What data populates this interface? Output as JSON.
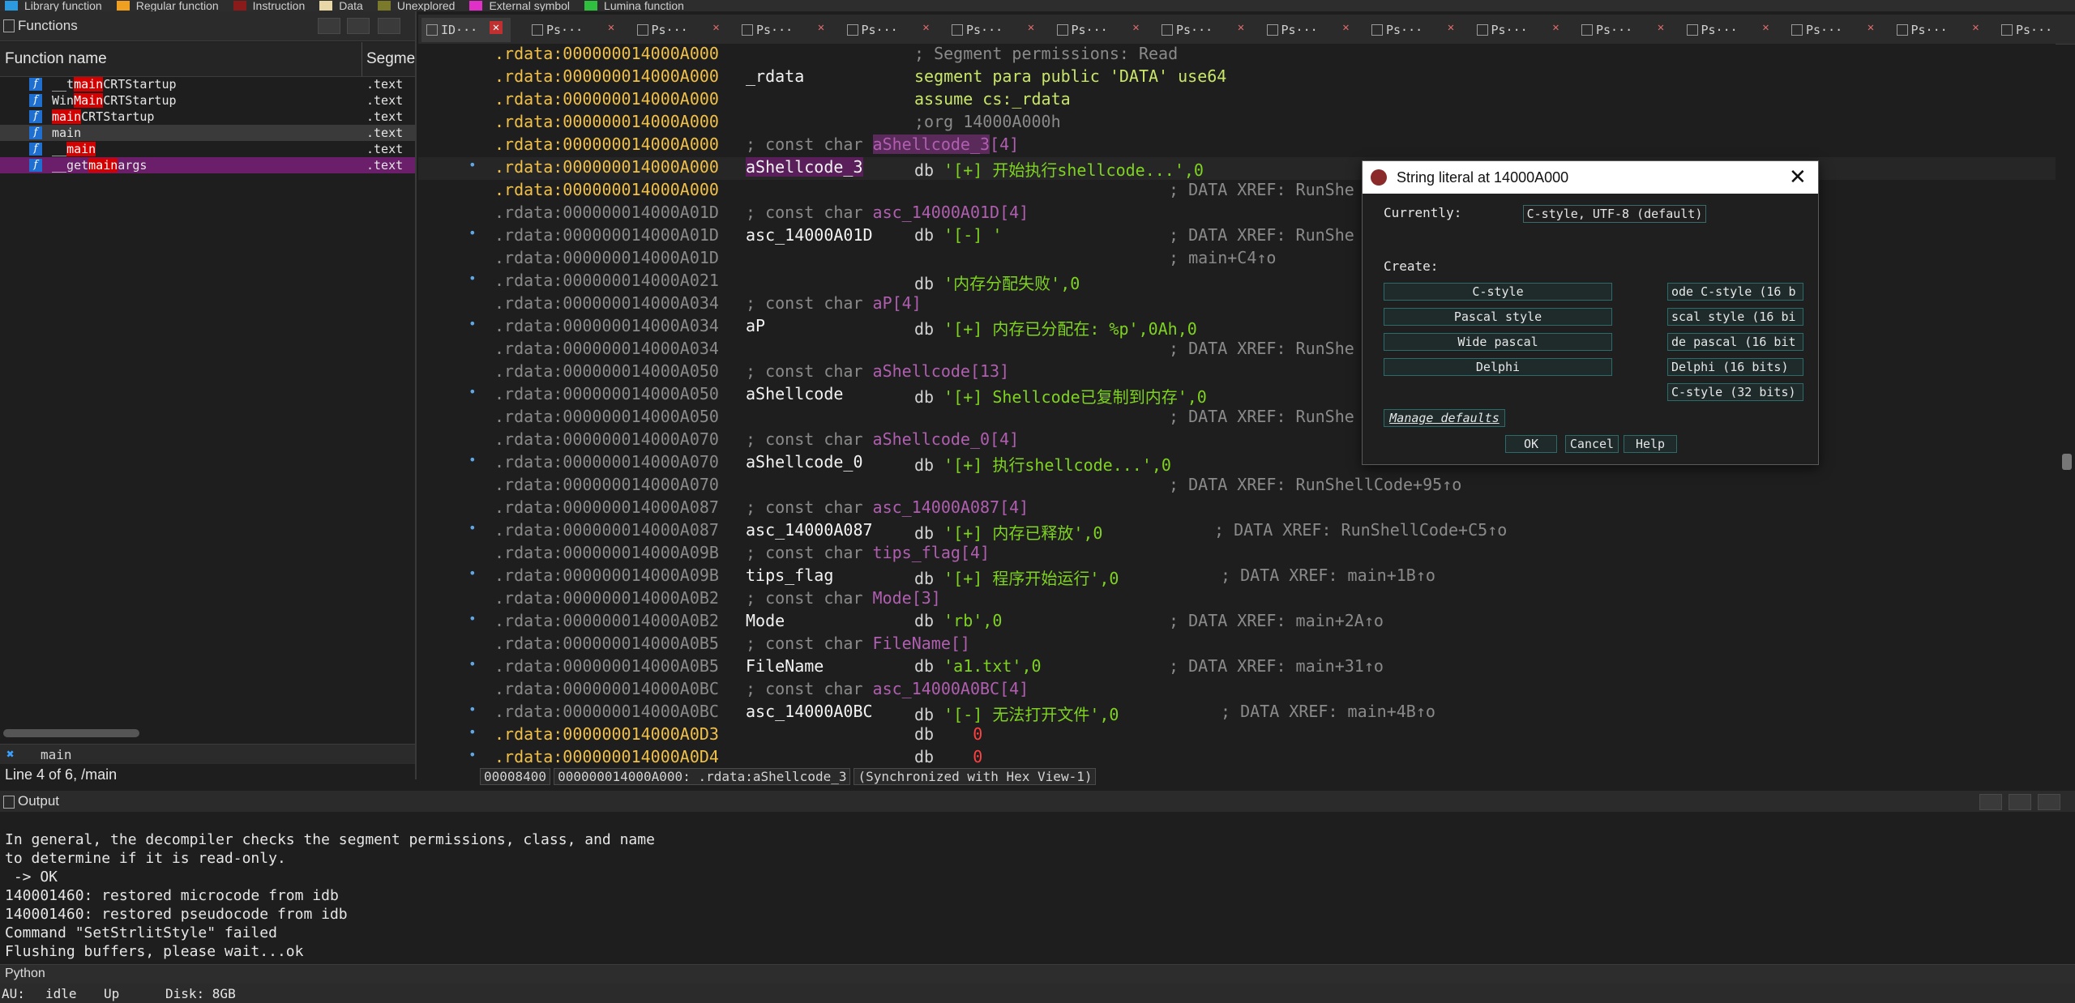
{
  "legend": [
    {
      "label": "Library function",
      "color": "#2b9ae0"
    },
    {
      "label": "Regular function",
      "color": "#f0a020"
    },
    {
      "label": "Instruction",
      "color": "#8b1a1a"
    },
    {
      "label": "Data",
      "color": "#e8d8a8"
    },
    {
      "label": "Unexplored",
      "color": "#7a7a2a"
    },
    {
      "label": "External symbol",
      "color": "#e030c8"
    },
    {
      "label": "Lumina function",
      "color": "#30c040"
    }
  ],
  "functions": {
    "title": "Functions",
    "col_name": "Function name",
    "col_segment": "Segme",
    "rows": [
      {
        "pre": "__t",
        "hl": "main",
        "post": "CRTStartup",
        "seg": ".text",
        "selected": false
      },
      {
        "pre": "Win",
        "hl": "Main",
        "post": "CRTStartup",
        "seg": ".text",
        "selected": false
      },
      {
        "pre": "",
        "hl": "main",
        "post": "CRTStartup",
        "seg": ".text",
        "selected": false
      },
      {
        "pre": "main",
        "hl": "",
        "post": "",
        "seg": ".text",
        "selected": true
      },
      {
        "pre": "__",
        "hl": "main",
        "post": "",
        "seg": ".text",
        "selected": false
      },
      {
        "pre": "__get",
        "hl": "main",
        "post": "args",
        "seg": ".text",
        "selected": false,
        "purple": true
      }
    ],
    "tab_label": "main",
    "status": "Line 4 of 6, /main"
  },
  "tabs": [
    {
      "label": "ID···",
      "active": true
    },
    {
      "label": "Ps···"
    },
    {
      "label": "Ps···"
    },
    {
      "label": "Ps···"
    },
    {
      "label": "Ps···"
    },
    {
      "label": "Ps···"
    },
    {
      "label": "Ps···"
    },
    {
      "label": "Ps···"
    },
    {
      "label": "Ps···"
    },
    {
      "label": "Ps···"
    },
    {
      "label": "Ps···"
    },
    {
      "label": "Ps···"
    },
    {
      "label": "Ps···"
    },
    {
      "label": "Ps···"
    },
    {
      "label": "Ps···"
    },
    {
      "label": "Ps···"
    }
  ],
  "disasm": [
    {
      "addr": ".rdata:000000014000A000",
      "addrc": "y",
      "rest": [
        {
          "t": "; Segment permissions: Read",
          "c": "cmt"
        }
      ]
    },
    {
      "addr": ".rdata:000000014000A000",
      "addrc": "y",
      "label": "_rdata",
      "rest": [
        {
          "t": "segment para public 'DATA' use64",
          "c": "kw"
        }
      ]
    },
    {
      "addr": ".rdata:000000014000A000",
      "addrc": "y",
      "rest": [
        {
          "t": "assume cs:_rdata",
          "c": "kw"
        }
      ]
    },
    {
      "addr": ".rdata:000000014000A000",
      "addrc": "y",
      "rest": [
        {
          "t": ";org 14000A000h",
          "c": "cmt"
        }
      ]
    },
    {
      "addr": ".rdata:000000014000A000",
      "addrc": "y",
      "comment": "; const char aShellcode_3[4]"
    },
    {
      "addr": ".rdata:000000014000A000",
      "addrc": "y",
      "dot": true,
      "label": "aShellcode_3",
      "labelhl": true,
      "rest": [
        {
          "t": "db ",
          "c": "op"
        },
        {
          "t": "'[+] 开始执行shellcode...'",
          "c": "str"
        },
        {
          "t": ",0",
          "c": "num"
        }
      ]
    },
    {
      "addr": ".rdata:000000014000A000",
      "addrc": "y",
      "xref": "; DATA XREF: RunShe"
    },
    {
      "addr": ".rdata:000000014000A01D",
      "addrc": "g",
      "comment": "; const char asc_14000A01D[4]"
    },
    {
      "addr": ".rdata:000000014000A01D",
      "addrc": "g",
      "dot": true,
      "label": "asc_14000A01D",
      "rest": [
        {
          "t": "db ",
          "c": "op"
        },
        {
          "t": "'[-] '",
          "c": "str"
        }
      ],
      "xref": "; DATA XREF: RunShe"
    },
    {
      "addr": ".rdata:000000014000A01D",
      "addrc": "g",
      "xref": "; main+C4↑o"
    },
    {
      "addr": ".rdata:000000014000A021",
      "addrc": "g",
      "dot": true,
      "rest": [
        {
          "t": "db ",
          "c": "op"
        },
        {
          "t": "'内存分配失败'",
          "c": "str"
        },
        {
          "t": ",0",
          "c": "num"
        }
      ]
    },
    {
      "addr": ".rdata:000000014000A034",
      "addrc": "g",
      "comment": "; const char aP[4]"
    },
    {
      "addr": ".rdata:000000014000A034",
      "addrc": "g",
      "dot": true,
      "label": "aP",
      "rest": [
        {
          "t": "db ",
          "c": "op"
        },
        {
          "t": "'[+] 内存已分配在: %p'",
          "c": "str"
        },
        {
          "t": ",0Ah,0",
          "c": "num"
        }
      ]
    },
    {
      "addr": ".rdata:000000014000A034",
      "addrc": "g",
      "xref": "; DATA XREF: RunShe"
    },
    {
      "addr": ".rdata:000000014000A050",
      "addrc": "g",
      "comment": "; const char aShellcode[13]"
    },
    {
      "addr": ".rdata:000000014000A050",
      "addrc": "g",
      "dot": true,
      "label": "aShellcode",
      "rest": [
        {
          "t": "db ",
          "c": "op"
        },
        {
          "t": "'[+] Shellcode已复制到内存'",
          "c": "str"
        },
        {
          "t": ",0",
          "c": "num"
        }
      ]
    },
    {
      "addr": ".rdata:000000014000A050",
      "addrc": "g",
      "xref": "; DATA XREF: RunShe"
    },
    {
      "addr": ".rdata:000000014000A070",
      "addrc": "g",
      "comment": "; const char aShellcode_0[4]"
    },
    {
      "addr": ".rdata:000000014000A070",
      "addrc": "g",
      "dot": true,
      "label": "aShellcode_0",
      "rest": [
        {
          "t": "db ",
          "c": "op"
        },
        {
          "t": "'[+] 执行shellcode...'",
          "c": "str"
        },
        {
          "t": ",0",
          "c": "num"
        }
      ]
    },
    {
      "addr": ".rdata:000000014000A070",
      "addrc": "g",
      "xref": "; DATA XREF: RunShellCode+95↑o"
    },
    {
      "addr": ".rdata:000000014000A087",
      "addrc": "g",
      "comment": "; const char asc_14000A087[4]"
    },
    {
      "addr": ".rdata:000000014000A087",
      "addrc": "g",
      "dot": true,
      "label": "asc_14000A087",
      "rest": [
        {
          "t": "db ",
          "c": "op"
        },
        {
          "t": "'[+] 内存已释放'",
          "c": "str"
        },
        {
          "t": ",0",
          "c": "num"
        }
      ],
      "xref2": "; DATA XREF: RunShellCode+C5↑o"
    },
    {
      "addr": ".rdata:000000014000A09B",
      "addrc": "g",
      "comment": "; const char tips_flag[4]"
    },
    {
      "addr": ".rdata:000000014000A09B",
      "addrc": "g",
      "dot": true,
      "label": "tips_flag",
      "rest": [
        {
          "t": "db ",
          "c": "op"
        },
        {
          "t": "'[+] 程序开始运行'",
          "c": "str"
        },
        {
          "t": ",0",
          "c": "num"
        }
      ],
      "xref2": "; DATA XREF: main+1B↑o"
    },
    {
      "addr": ".rdata:000000014000A0B2",
      "addrc": "g",
      "comment": "; const char Mode[3]"
    },
    {
      "addr": ".rdata:000000014000A0B2",
      "addrc": "g",
      "dot": true,
      "label": "Mode",
      "rest": [
        {
          "t": "db ",
          "c": "op"
        },
        {
          "t": "'rb'",
          "c": "str"
        },
        {
          "t": ",0",
          "c": "num"
        }
      ],
      "xref": "; DATA XREF: main+2A↑o"
    },
    {
      "addr": ".rdata:000000014000A0B5",
      "addrc": "g",
      "comment": "; const char FileName[]"
    },
    {
      "addr": ".rdata:000000014000A0B5",
      "addrc": "g",
      "dot": true,
      "label": "FileName",
      "rest": [
        {
          "t": "db ",
          "c": "op"
        },
        {
          "t": "'a1.txt'",
          "c": "str"
        },
        {
          "t": ",0",
          "c": "num"
        }
      ],
      "xref": "; DATA XREF: main+31↑o"
    },
    {
      "addr": ".rdata:000000014000A0BC",
      "addrc": "g",
      "comment": "; const char asc_14000A0BC[4]"
    },
    {
      "addr": ".rdata:000000014000A0BC",
      "addrc": "g",
      "dot": true,
      "label": "asc_14000A0BC",
      "rest": [
        {
          "t": "db ",
          "c": "op"
        },
        {
          "t": "'[-] 无法打开文件'",
          "c": "str"
        },
        {
          "t": ",0",
          "c": "num"
        }
      ],
      "xref2": "; DATA XREF: main+4B↑o"
    },
    {
      "addr": ".rdata:000000014000A0D3",
      "addrc": "y",
      "dot": true,
      "rest": [
        {
          "t": "db    ",
          "c": "op"
        },
        {
          "t": "0",
          "c": "red"
        }
      ]
    },
    {
      "addr": ".rdata:000000014000A0D4",
      "addrc": "y",
      "dot": true,
      "rest": [
        {
          "t": "db    ",
          "c": "op"
        },
        {
          "t": "0",
          "c": "red"
        }
      ]
    }
  ],
  "disasm_status": {
    "offset": "00008400",
    "loc": "000000014000A000: .rdata:aShellcode_3",
    "sync": "(Synchronized with Hex View-1)"
  },
  "output": {
    "title": "Output",
    "lines": [
      "In general, the decompiler checks the segment permissions, class, and name",
      "to determine if it is read-only.",
      " -> OK",
      "140001460: restored microcode from idb",
      "140001460: restored pseudocode from idb",
      "Command \"SetStrlitStyle\" failed",
      "Flushing buffers, please wait...ok"
    ]
  },
  "python_label": "Python",
  "statusbar": {
    "au": "AU:",
    "state": "idle",
    "up": "Up",
    "disk": "Disk: 8GB"
  },
  "dialog": {
    "title": "String literal at 14000A000",
    "currently_label": "Currently:",
    "currently_value": "C-style, UTF-8 (default)",
    "create_label": "Create:",
    "left_buttons": [
      "C-style",
      "Pascal style",
      "Wide pascal",
      "Delphi"
    ],
    "right_buttons": [
      "ode C-style (16 b",
      "scal style (16 bi",
      "de pascal (16 bit",
      "Delphi (16 bits)",
      "C-style (32 bits)"
    ],
    "manage": "Manage defaults",
    "ok": "OK",
    "cancel": "Cancel",
    "help": "Help"
  }
}
